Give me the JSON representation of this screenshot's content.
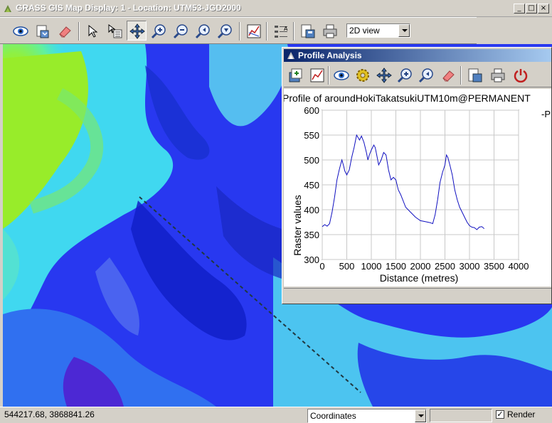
{
  "window": {
    "title": "GRASS GIS Map Display: 1 - Location: UTM53-JGD2000",
    "min_glyph": "_",
    "max_glyph": "□",
    "close_glyph": "×"
  },
  "toolbar": {
    "buttons": [
      "display-map",
      "render-map",
      "erase",
      "pointer",
      "query",
      "pan",
      "zoom-in",
      "zoom-out",
      "zoom-back",
      "zoom-menu",
      "analyze",
      "overlay-decorations",
      "save",
      "print"
    ],
    "view_mode": "2D view"
  },
  "statusbar": {
    "coordinates": "544217.68, 3868841.26",
    "mode_select": "Coordinates",
    "render_label": "Render",
    "render_checked": "✓"
  },
  "profile_window": {
    "title": "Profile Analysis",
    "buttons": [
      "add-raster",
      "draw-transect",
      "display",
      "settings",
      "pan",
      "zoom-in",
      "zoom-back",
      "erase",
      "save",
      "print",
      "quit"
    ]
  },
  "chart_data": {
    "type": "line",
    "title": "Profile of aroundHokiTakatsukiUTM10m@PERMANENT",
    "legend_fragment": "-P",
    "xlabel": "Distance (metres)",
    "ylabel": "Raster values",
    "xlim": [
      0,
      4000
    ],
    "ylim": [
      300,
      600
    ],
    "xticks": [
      "0",
      "500",
      "1000",
      "1500",
      "2000",
      "2500",
      "3000",
      "3500",
      "4000"
    ],
    "yticks": [
      "300",
      "350",
      "400",
      "450",
      "500",
      "550",
      "600"
    ],
    "grid": true,
    "color": "#1010c0",
    "series": [
      {
        "x": [
          0,
          50,
          100,
          150,
          200,
          250,
          300,
          350,
          400,
          430,
          460,
          500,
          550,
          600,
          650,
          700,
          730,
          760,
          800,
          850,
          900,
          930,
          960,
          1000,
          1050,
          1080,
          1110,
          1150,
          1200,
          1250,
          1300,
          1350,
          1400,
          1450,
          1500,
          1550,
          1600,
          1700,
          1800,
          1900,
          2000,
          2100,
          2200,
          2250,
          2300,
          2350,
          2400,
          2450,
          2500,
          2530,
          2560,
          2600,
          2650,
          2700,
          2750,
          2800,
          2850,
          2900,
          2950,
          3000,
          3050,
          3100,
          3150,
          3200,
          3250,
          3300
        ],
        "y": [
          366,
          370,
          367,
          372,
          395,
          425,
          460,
          482,
          500,
          490,
          478,
          470,
          480,
          505,
          525,
          550,
          545,
          540,
          548,
          535,
          515,
          500,
          510,
          520,
          530,
          525,
          510,
          490,
          500,
          515,
          510,
          480,
          460,
          465,
          460,
          440,
          430,
          405,
          395,
          385,
          378,
          376,
          374,
          372,
          390,
          420,
          455,
          475,
          490,
          510,
          505,
          490,
          470,
          440,
          420,
          405,
          395,
          385,
          375,
          368,
          365,
          364,
          360,
          365,
          366,
          362
        ]
      }
    ]
  }
}
